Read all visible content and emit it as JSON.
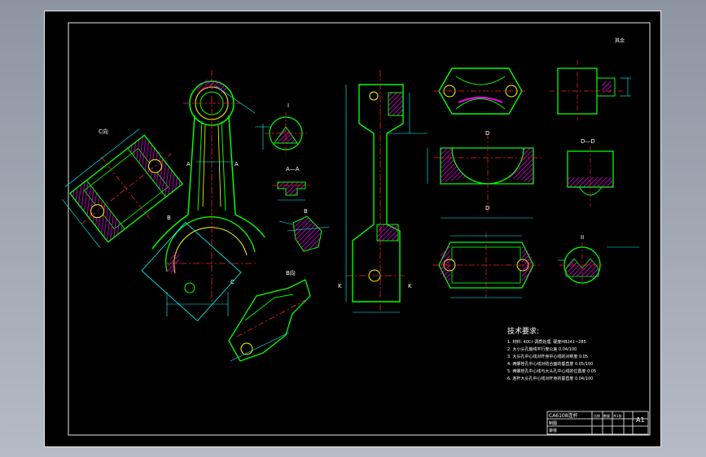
{
  "sheet": {
    "corner_mark": "其余",
    "view_labels": {
      "c_view": "C向",
      "b_view": "B向",
      "section_aa": "A—A",
      "section_dd": "D—D",
      "detail_i": "I",
      "detail_ii": "II",
      "section_ba": "B",
      "letter_a_left": "A",
      "letter_a_right": "A",
      "letter_c": "C",
      "letter_b": "B",
      "letter_k_left": "K",
      "letter_k_right": "K",
      "letter_d_top": "D",
      "letter_d_bottom": "D"
    }
  },
  "tech_requirements": {
    "title": "技术要求:",
    "items": [
      "1. 材料: 40Cr 调质处理, 硬度HB241~285",
      "2. 大小头孔轴线平行度公差 0.04/100",
      "3. 大头孔中心线对杆身中心线的对称度 0.05",
      "4. 两螺栓孔中心线对结合面的垂直度 0.05/100",
      "5. 两螺栓孔中心线与大头孔中心线的位置度 0.05",
      "6. 连杆大头孔中心线对杆身的垂直度 0.04/100"
    ]
  },
  "title_block": {
    "name": "CA6108连杆",
    "scale_label": "比例",
    "qty_label": "数量",
    "sheet_label": "共1张",
    "drawn_label": "制图",
    "check_label": "审核",
    "size": "A1"
  },
  "colors": {
    "outline": "#00ff00",
    "dimension": "#00ffff",
    "hatch": "#ff00ff",
    "centerline": "#ff2020",
    "hidden": "#ffff00",
    "text": "#ffffff",
    "frame": "#e8e8e8"
  }
}
